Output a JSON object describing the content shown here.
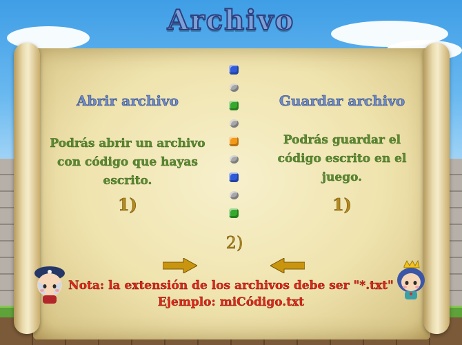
{
  "title": "Archivo",
  "left": {
    "heading": "Abrir archivo",
    "desc_lines": [
      "Podrás abrir un archivo",
      "con código que hayas",
      "escrito."
    ],
    "step": "1)"
  },
  "right": {
    "heading": "Guardar archivo",
    "desc_lines": [
      "Podrás guardar el",
      "código escrito en el",
      "juego."
    ],
    "step": "1)"
  },
  "center_step": "2)",
  "gems": [
    "blue",
    "grey",
    "green",
    "grey",
    "orange",
    "grey",
    "blue",
    "grey",
    "green"
  ],
  "note": {
    "line1": "Nota: la extensión de los archivos debe ser \"*.txt\"",
    "line2": "Ejemplo: miCódigo.txt"
  },
  "colors": {
    "arrow": "#c9950e",
    "note": "#e0261a",
    "heading": "#6e8bc8",
    "desc": "#5b8a30"
  },
  "icons": {
    "left_avatar": "pirate-character-icon",
    "right_avatar": "princess-character-icon",
    "left_arrow": "arrow-right-icon",
    "right_arrow": "arrow-left-icon"
  }
}
